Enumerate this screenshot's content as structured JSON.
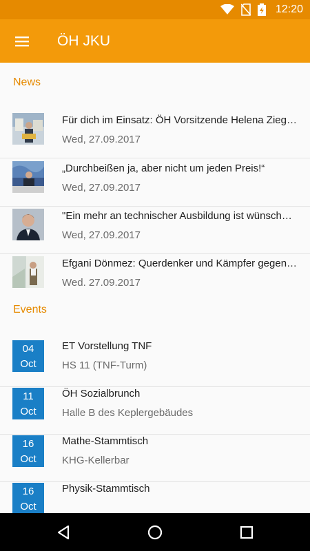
{
  "status_bar": {
    "time": "12:20",
    "icons": [
      "wifi-icon",
      "no-sim-icon",
      "battery-charging-icon"
    ]
  },
  "app_bar": {
    "title": "ÖH JKU",
    "menu_icon": "menu-icon"
  },
  "news": {
    "header": "News",
    "items": [
      {
        "title": "Für dich im Einsatz: ÖH Vorsitzende Helena Ziegler",
        "date": "Wed, 27.09.2017"
      },
      {
        "title": "„Durchbeißen ja, aber nicht um jeden Preis!“",
        "date": "Wed, 27.09.2017"
      },
      {
        "title": "\"Ein mehr an technischer Ausbildung ist wünschenswert\"",
        "date": "Wed, 27.09.2017"
      },
      {
        "title": "Efgani Dönmez: Querdenker und Kämpfer gegen den Extremismus",
        "date": "Wed. 27.09.2017"
      }
    ]
  },
  "events": {
    "header": "Events",
    "items": [
      {
        "day": "04",
        "month": "Oct",
        "title": "ET Vorstellung TNF",
        "location": "HS 11 (TNF-Turm)"
      },
      {
        "day": "11",
        "month": "Oct",
        "title": "ÖH Sozialbrunch",
        "location": "Halle B des Keplergebäudes"
      },
      {
        "day": "16",
        "month": "Oct",
        "title": "Mathe-Stammtisch",
        "location": "KHG-Kellerbar"
      },
      {
        "day": "16",
        "month": "Oct",
        "title": "Physik-Stammtisch",
        "location": ""
      }
    ]
  },
  "nav_bar": {
    "buttons": [
      "back-icon",
      "home-icon",
      "recents-icon"
    ]
  },
  "colors": {
    "status_bar": "#e68a00",
    "app_bar": "#f39a0a",
    "section_header": "#e68a00",
    "date_box": "#1a7fc6"
  }
}
